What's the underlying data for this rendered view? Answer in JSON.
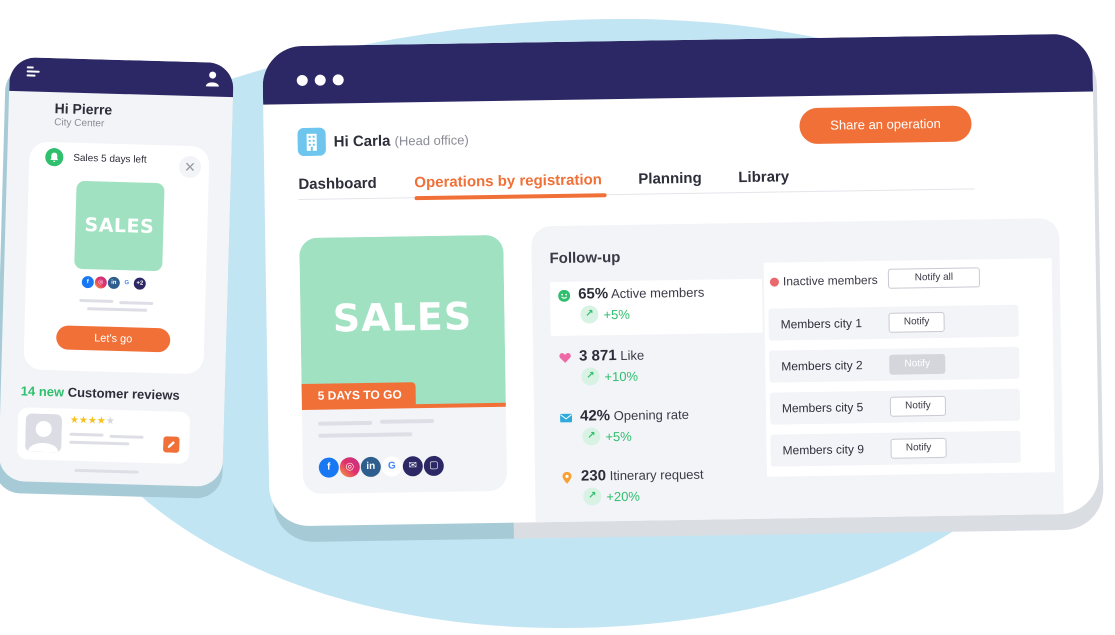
{
  "colors": {
    "navy": "#2c2865",
    "orange": "#f07037",
    "mint": "#a0e1c1",
    "green": "#2fbf6d",
    "sky": "#c1e5f3"
  },
  "phone": {
    "menu_icon": "hamburger-menu-icon",
    "user_icon": "user-icon",
    "greeting": "Hi Pierre",
    "location": "City Center",
    "notification": {
      "icon": "bell-icon",
      "title": "Sales 5 days left",
      "close_icon": "close-icon",
      "image_text": "SALES",
      "socials": [
        "facebook",
        "instagram",
        "linkedin",
        "google"
      ],
      "more_count": "+2",
      "cta": "Let's go"
    },
    "reviews": {
      "count_label": "14 new",
      "title": "Customer reviews",
      "rating": 4,
      "rating_max": 5,
      "edit_icon": "pencil-icon"
    }
  },
  "window": {
    "greeting_name": "Hi Carla",
    "greeting_office": "(Head office)",
    "share_button": "Share an operation",
    "tabs": [
      {
        "label": "Dashboard",
        "active": false
      },
      {
        "label": "Operations by registration",
        "active": true
      },
      {
        "label": "Planning",
        "active": false
      },
      {
        "label": "Library",
        "active": false
      }
    ],
    "operation_card": {
      "image_text": "SALES",
      "badge": "5 DAYS TO GO",
      "channels": [
        "facebook",
        "instagram",
        "linkedin",
        "google",
        "email",
        "chat"
      ]
    },
    "followup": {
      "title": "Follow-up",
      "stats": [
        {
          "icon": "smiley-icon",
          "value": "65%",
          "label": "Active members",
          "trend": "+5%"
        },
        {
          "icon": "heart-icon",
          "value": "3 871",
          "label": "Like",
          "trend": "+10%"
        },
        {
          "icon": "envelope-icon",
          "value": "42%",
          "label": "Opening rate",
          "trend": "+5%"
        },
        {
          "icon": "location-pin-icon",
          "value": "230",
          "label": "Itinerary request",
          "trend": "+20%"
        }
      ],
      "inactive": {
        "label": "Inactive members",
        "notify_all": "Notify all",
        "cities": [
          {
            "label": "Members city 1",
            "button": "Notify",
            "disabled": false
          },
          {
            "label": "Members city 2",
            "button": "Notify",
            "disabled": true
          },
          {
            "label": "Members city 5",
            "button": "Notify",
            "disabled": false
          },
          {
            "label": "Members city 9",
            "button": "Notify",
            "disabled": false
          }
        ]
      }
    }
  }
}
